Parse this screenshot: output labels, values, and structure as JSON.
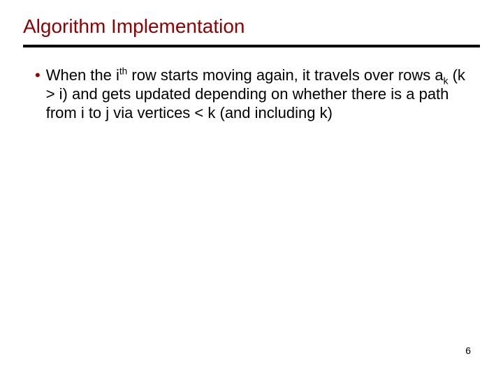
{
  "title": "Algorithm Implementation",
  "bullet": {
    "mark": "•",
    "pre": "When the i",
    "sup1": "th",
    "mid1": " row starts moving again, it travels over rows a",
    "sub1": "k",
    "post": " (k > i) and gets updated depending on whether there is a path from i to j via vertices < k (and including k)"
  },
  "page_number": "6"
}
